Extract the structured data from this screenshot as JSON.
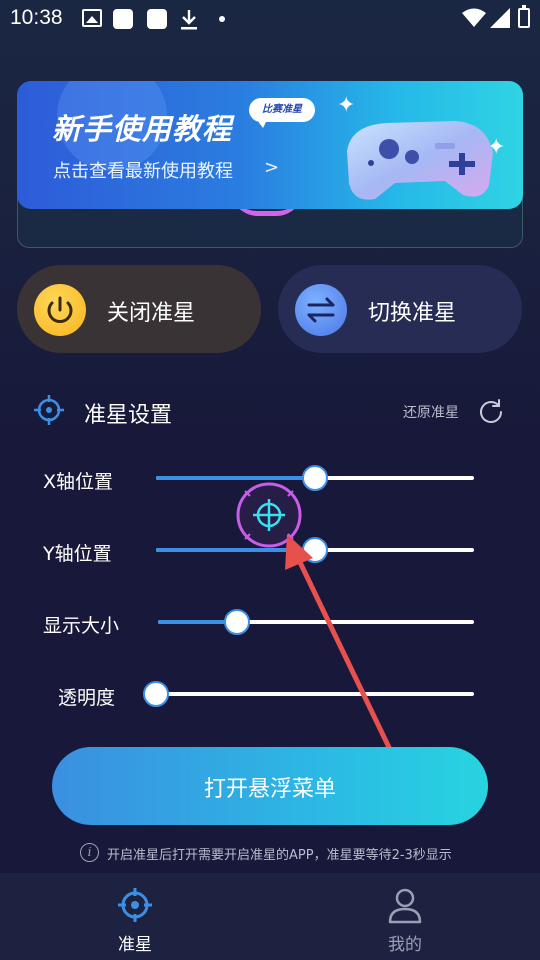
{
  "status_bar": {
    "time": "10:38"
  },
  "banner": {
    "title": "新手使用教程",
    "bubble": "比赛准星",
    "subtitle": "点击查看最新使用教程",
    "chevron": ">"
  },
  "controls": {
    "close_label": "关闭准星",
    "switch_label": "切换准星"
  },
  "settings": {
    "title": "准星设置",
    "reset_label": "还原准星",
    "sliders": [
      {
        "label": "X轴位置",
        "value": 0.5
      },
      {
        "label": "Y轴位置",
        "value": 0.5
      },
      {
        "label": "显示大小",
        "value": 0.25
      },
      {
        "label": "透明度",
        "value": 0.0
      }
    ]
  },
  "float_menu": {
    "label": "打开悬浮菜单"
  },
  "info": {
    "text": "开启准星后打开需要开启准星的APP，准星要等待2-3秒显示"
  },
  "nav": {
    "items": [
      {
        "label": "准星",
        "active": true
      },
      {
        "label": "我的",
        "active": false
      }
    ]
  },
  "colors": {
    "background": "#18193a",
    "accent": "#3d8fe6",
    "crosshair_ring": "#c65ee8",
    "crosshair_center": "#38e0f0",
    "arrow": "#e8504e"
  }
}
